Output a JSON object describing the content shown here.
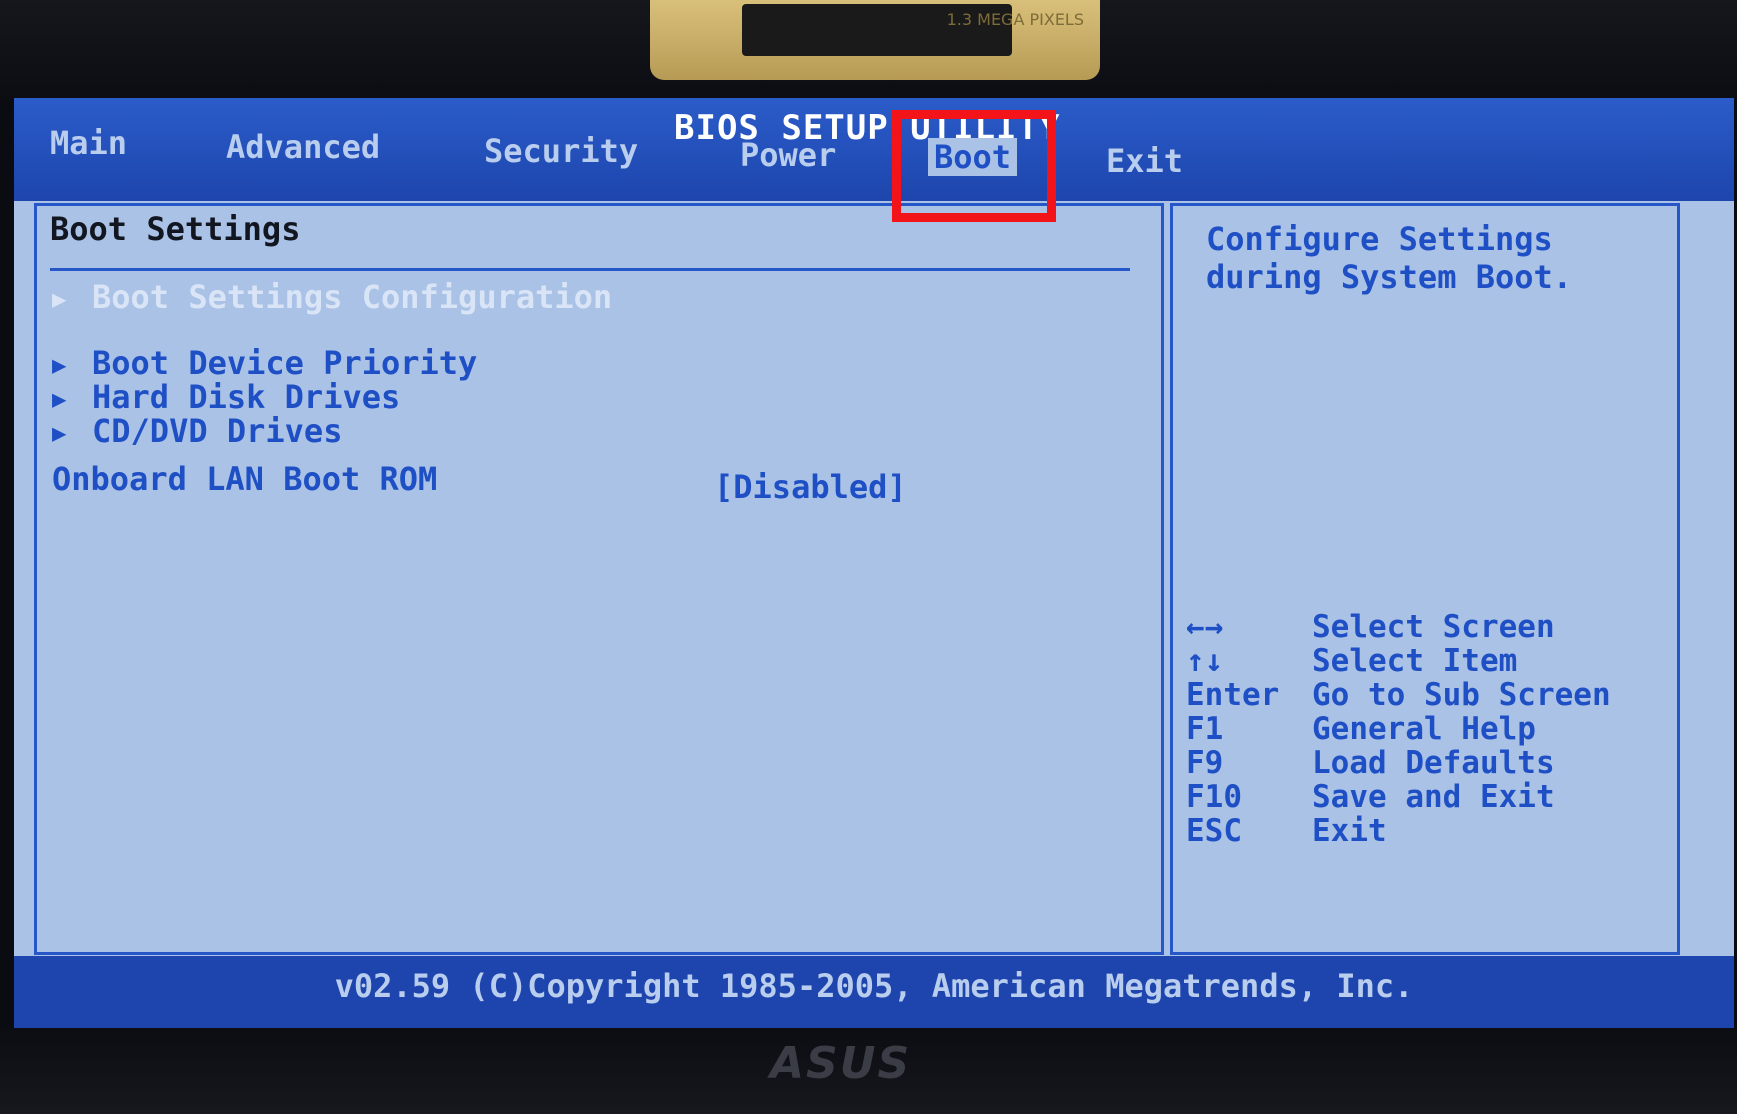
{
  "camera_label": "1.3 MEGA PIXELS",
  "title": "BIOS SETUP UTILITY",
  "tabs": [
    {
      "label": "Main"
    },
    {
      "label": "Advanced"
    },
    {
      "label": "Security"
    },
    {
      "label": "Power"
    },
    {
      "label": "Boot"
    },
    {
      "label": "Exit"
    }
  ],
  "active_tab": "Boot",
  "main": {
    "heading": "Boot Settings",
    "items": [
      {
        "label": "Boot Settings Configuration"
      },
      {
        "label": "Boot Device Priority"
      },
      {
        "label": "Hard Disk Drives"
      },
      {
        "label": "CD/DVD Drives"
      }
    ],
    "onboard_lan": {
      "label": "Onboard LAN Boot ROM",
      "value": "[Disabled]"
    }
  },
  "help": {
    "description": "Configure Settings during System Boot.",
    "keys": [
      {
        "key": "←→",
        "action": "Select Screen"
      },
      {
        "key": "↑↓",
        "action": "Select Item"
      },
      {
        "key": "Enter",
        "action": "Go to Sub Screen"
      },
      {
        "key": "F1",
        "action": "General Help"
      },
      {
        "key": "F9",
        "action": "Load Defaults"
      },
      {
        "key": "F10",
        "action": "Save and Exit"
      },
      {
        "key": "ESC",
        "action": "Exit"
      }
    ]
  },
  "footer": "v02.59 (C)Copyright 1985-2005, American Megatrends, Inc.",
  "brand": "ASUS",
  "colors": {
    "screen_bg": "#a9c2e6",
    "title_bar": "#1d45ad",
    "text_blue": "#1f4fc4",
    "highlight_box": "#f21418"
  }
}
